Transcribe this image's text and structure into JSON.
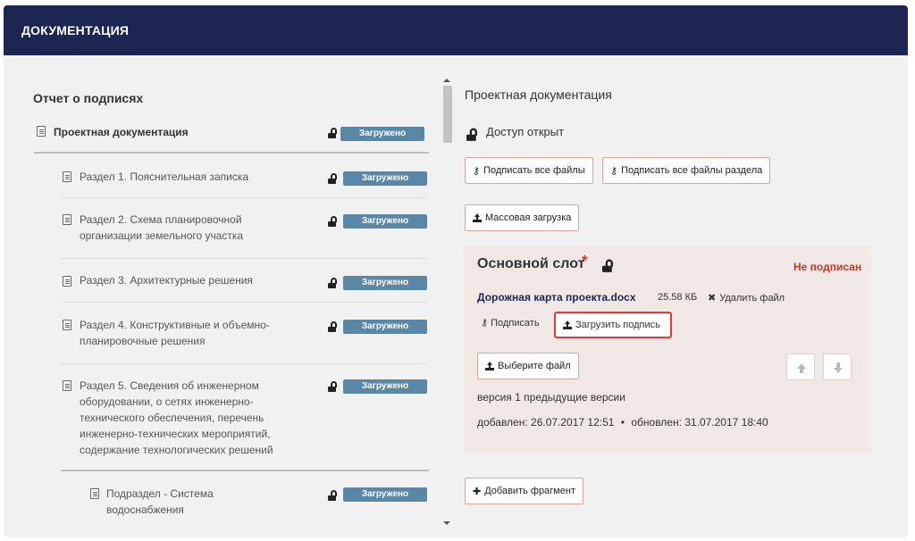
{
  "header": {
    "title": "ДОКУМЕНТАЦИЯ"
  },
  "left": {
    "title": "Отчет о подписях",
    "top_item": {
      "label": "Проектная документация",
      "status": "Загружено"
    },
    "items": [
      {
        "lines": [
          "Раздел 1. Пояснительная записка"
        ],
        "status": "Загружено"
      },
      {
        "lines": [
          "Раздел 2. Схема планировочной",
          "организации земельного участка"
        ],
        "status": "Загружено"
      },
      {
        "lines": [
          "Раздел 3. Архитектурные решения"
        ],
        "status": "Загружено"
      },
      {
        "lines": [
          "Раздел 4. Конструктивные и объемно-",
          "планировочные решения"
        ],
        "status": "Загружено"
      },
      {
        "lines": [
          "Раздел 5. Сведения об инженерном",
          "оборудовании, о сетях инженерно-",
          "технического обеспечения, перечень",
          "инженерно-технических мероприятий,",
          "содержание технологических решений"
        ],
        "status": "Загружено"
      }
    ],
    "sub_item": {
      "lines": [
        "Подраздел - Система",
        "водоснабжения"
      ],
      "status": "Загружено"
    }
  },
  "right": {
    "title": "Проектная документация",
    "access": "Доступ открыт",
    "buttons": {
      "sign_all": "Подписать все файлы",
      "sign_section": "Подписать все файлы раздела",
      "bulk_upload": "Массовая загрузка",
      "add_fragment": "Добавить фрагмент"
    },
    "slot": {
      "title": "Основной слот",
      "required_mark": "*",
      "sign_status": "Не подписан",
      "file_name": "Дорожная карта проекта.docx",
      "file_size": "25.58 КБ",
      "delete_label": "Удалить файл",
      "sign_label": "Подписать",
      "upload_sign_label": "Загрузить подпись",
      "choose_file_label": "Выберите файл",
      "version_label": "версия 1",
      "prev_versions_label": "предыдущие версии",
      "added_label": "добавлен: 26.07.2017 12:51",
      "separator": "•",
      "updated_label": "обновлен: 31.07.2017 18:40"
    }
  },
  "colors": {
    "header_bg": "#1d2552",
    "badge_bg": "#5a87a6",
    "slot_bg": "#efe8e4",
    "status_red": "#c0392b",
    "highlight": "#e53935"
  }
}
